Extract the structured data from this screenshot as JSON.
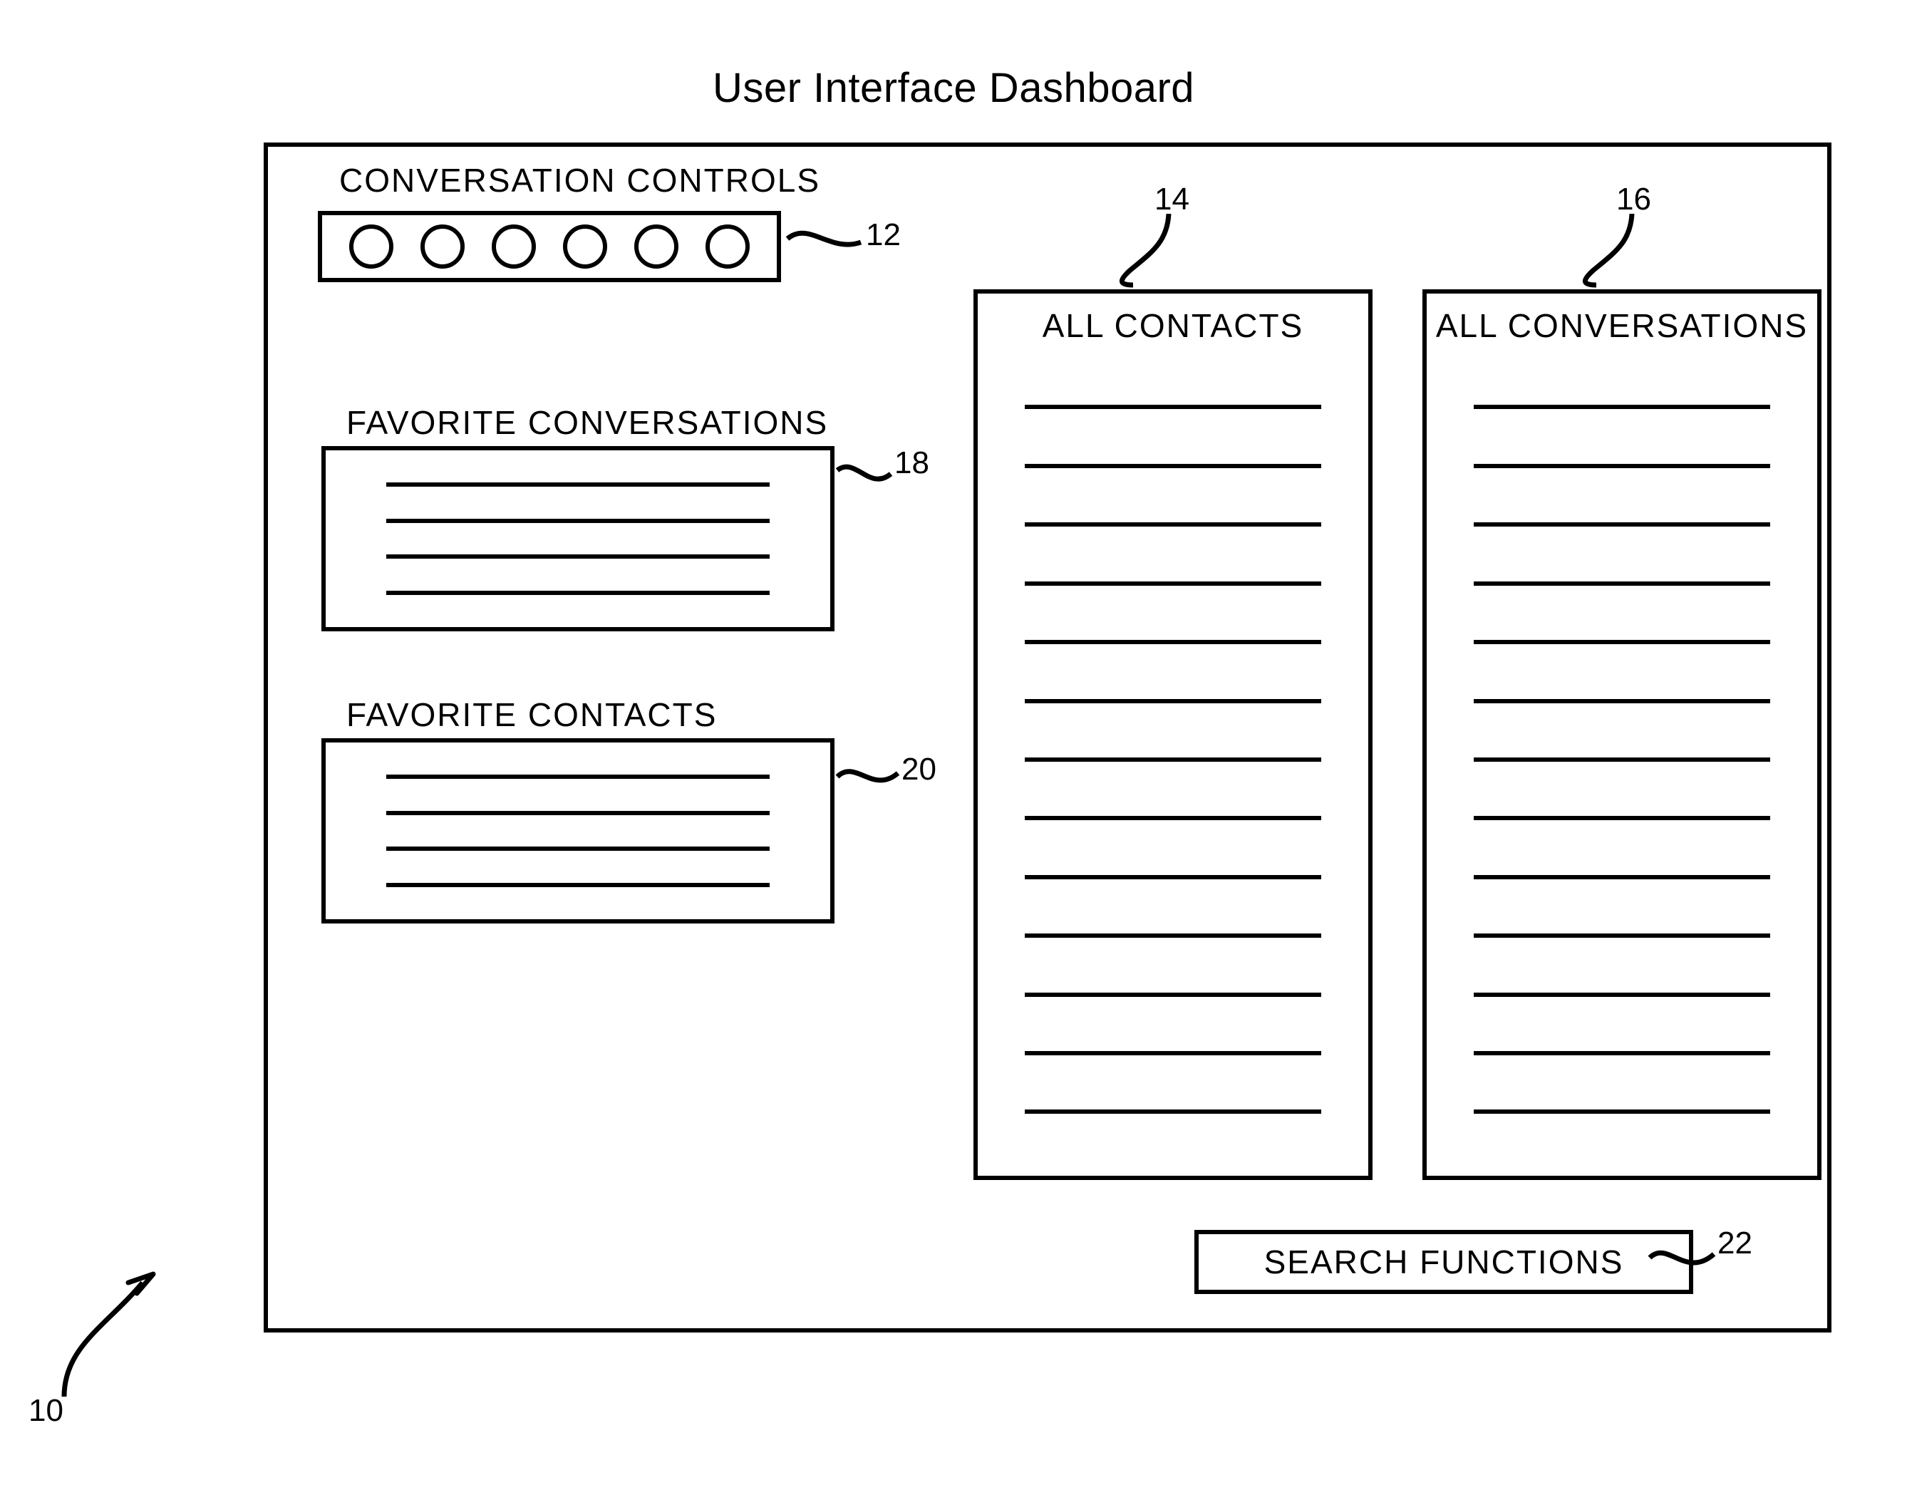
{
  "title": "User Interface Dashboard",
  "labels": {
    "conversation_controls": "CONVERSATION CONTROLS",
    "favorite_conversations": "FAVORITE CONVERSATIONS",
    "favorite_contacts": "FAVORITE CONTACTS",
    "all_contacts": "ALL CONTACTS",
    "all_conversations": "ALL CONVERSATIONS",
    "search_functions": "SEARCH FUNCTIONS"
  },
  "refs": {
    "frame": "10",
    "controls": "12",
    "all_contacts": "14",
    "all_conversations": "16",
    "fav_conversations": "18",
    "fav_contacts": "20",
    "search": "22"
  },
  "counts": {
    "control_circles": 6,
    "fav_conv_lines": 4,
    "fav_cont_lines": 4,
    "all_contacts_lines": 13,
    "all_conversations_lines": 13
  }
}
